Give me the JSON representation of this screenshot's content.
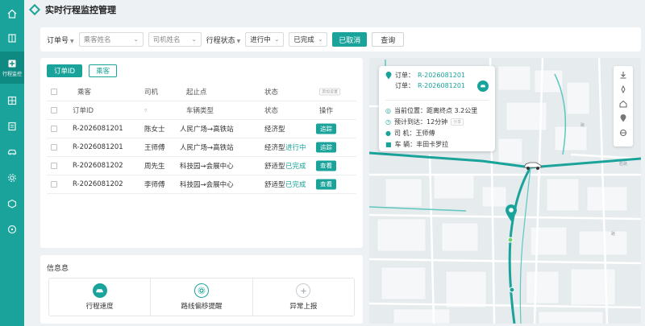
{
  "sidebar": {
    "items": [
      {
        "icon": "home-icon"
      },
      {
        "icon": "book-icon"
      },
      {
        "icon": "monitor-icon",
        "label": "行程监控"
      },
      {
        "icon": "grid-icon"
      },
      {
        "icon": "list-icon"
      },
      {
        "icon": "car-icon"
      },
      {
        "icon": "gear-icon"
      },
      {
        "icon": "box-icon"
      },
      {
        "icon": "circle-icon"
      }
    ],
    "accent": "#1aa39a"
  },
  "header": {
    "title": "实时行程监控管理"
  },
  "filter": {
    "order_label": "订单号",
    "passenger_placeholder": "乘客姓名",
    "driver_placeholder": "司机姓名",
    "status_label": "行程状态",
    "status_value": "进行中",
    "status_value2": "已完成",
    "cancelled_button": "已取消",
    "query_button": "查询"
  },
  "table": {
    "tabs": [
      "订单ID",
      "乘客"
    ],
    "header1": {
      "passenger": "乘客",
      "driver": "司机",
      "route": "起止点",
      "status": "状态",
      "mini": "添加设置"
    },
    "header2": {
      "order": "订单ID",
      "vehicle": "车辆类型",
      "status": "状态",
      "op": "操作"
    },
    "rows": [
      {
        "order": "R-2026081201",
        "driver": "陈女士",
        "route": "人民广场→高铁站",
        "type": "经济型",
        "status": "",
        "op": "追踪"
      },
      {
        "order": "R-2026081201",
        "driver": "王师傅",
        "route": "人民广场→高铁站",
        "type": "经济型",
        "status": "进行中",
        "op": "追踪"
      },
      {
        "order": "R-2026081202",
        "driver": "周先生",
        "route": "科技园→会展中心",
        "type": "舒适型",
        "status": "已完成",
        "op": "查看"
      },
      {
        "order": "R-2026081202",
        "driver": "李师傅",
        "route": "科技园→会展中心",
        "type": "舒适型",
        "status": "已完成",
        "op": "查看"
      }
    ]
  },
  "info": {
    "title": "信息息",
    "cards": [
      {
        "label": "行程速度",
        "icon": "car-icon"
      },
      {
        "label": "路线偏移提醒",
        "icon": "route-alert-icon"
      },
      {
        "label": "异常上报",
        "icon": "plus-circle-icon"
      }
    ]
  },
  "map": {
    "popup": {
      "order_label1": "订单：",
      "order_id1": "R-2026081201",
      "order_label2": "订单：",
      "order_id2": "R-2026081201",
      "location": "当前位置：距离终点 3.2公里",
      "eta": "预计到达：12分钟",
      "eta_tag": "分享",
      "driver": "司  机：王师傅",
      "vehicle": "车  辆：丰田卡罗拉"
    },
    "labels": [
      "路",
      "路",
      "胜路"
    ],
    "route_color": "#1aa39a"
  }
}
